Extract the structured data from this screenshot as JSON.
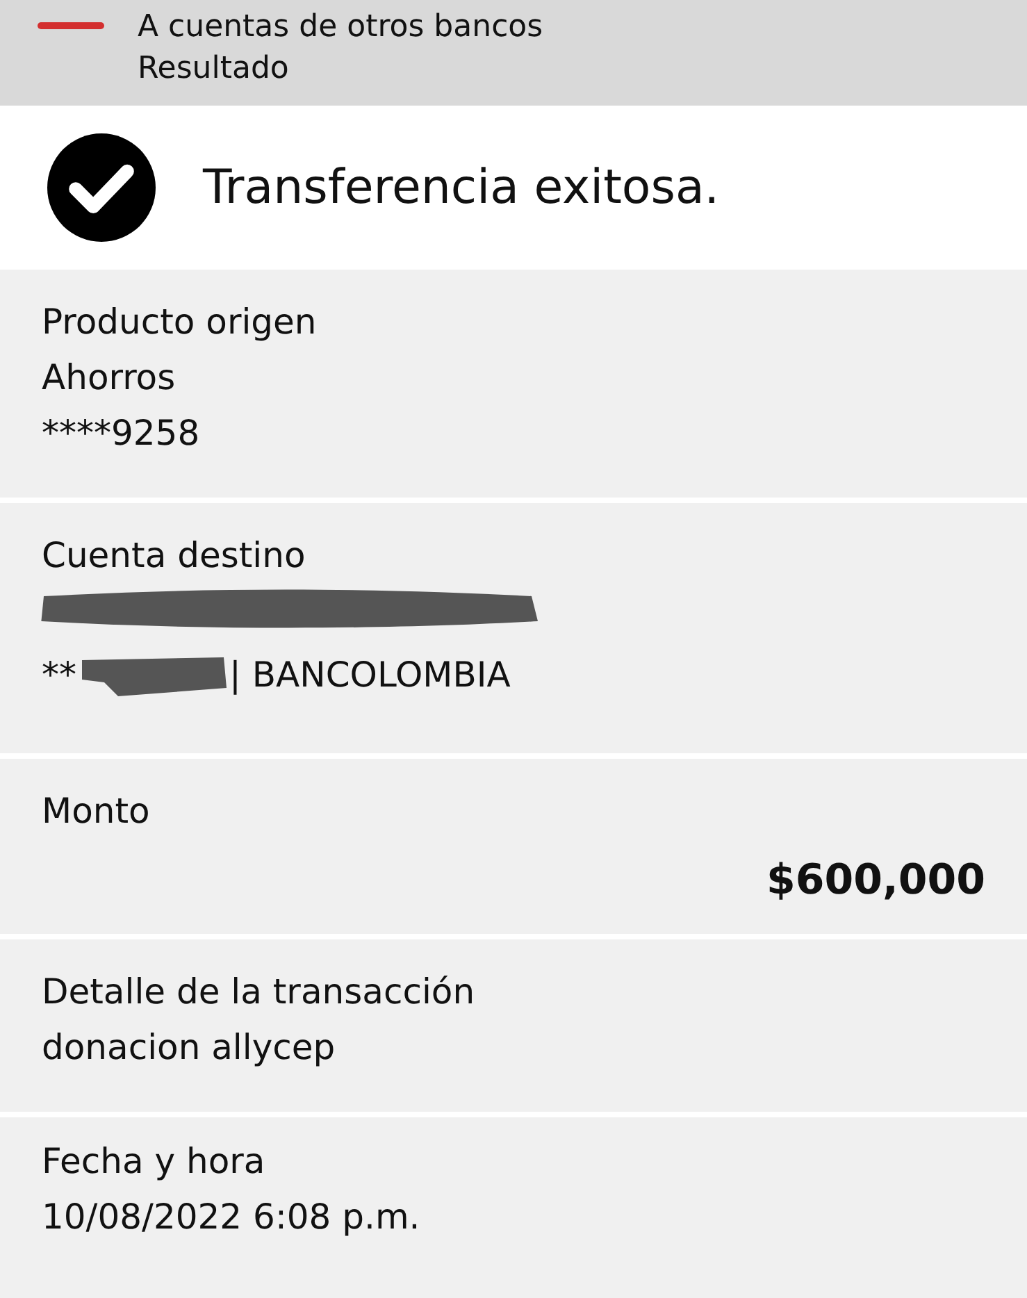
{
  "header": {
    "title": "A cuentas de otros bancos",
    "subtitle": "Resultado"
  },
  "status": {
    "kind": "success",
    "message": "Transferencia exitosa."
  },
  "sections": [
    {
      "kind": "lines",
      "label": "Producto origen",
      "lines": [
        "Ahorros",
        "****9258"
      ]
    },
    {
      "kind": "account",
      "label": "Cuenta destino",
      "prefix": "**",
      "bank": "| BANCOLOMBIA"
    },
    {
      "kind": "amount",
      "label": "Monto",
      "amount": "$600,000"
    },
    {
      "kind": "lines",
      "label": "Detalle de la transacción",
      "lines": [
        "donacion allycep"
      ]
    },
    {
      "kind": "lines",
      "label": "Fecha y hora",
      "lines": [
        "10/08/2022 6:08 p.m."
      ]
    }
  ]
}
